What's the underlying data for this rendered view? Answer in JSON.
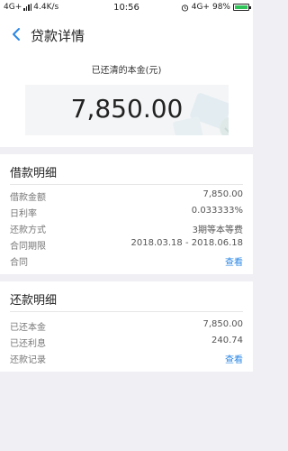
{
  "status_bar": {
    "network": "4G+",
    "speed": "4.4K/s",
    "time": "10:56",
    "network_right": "4G+",
    "battery": "98%",
    "battery_level": 0.98,
    "battery_color": "#2fc35a"
  },
  "nav": {
    "title": "贷款详情",
    "back_icon": "chevron-left-icon"
  },
  "summary": {
    "label": "已还清的本金(元)",
    "amount": "7,850.00"
  },
  "loan_details": {
    "title": "借款明细",
    "rows": [
      {
        "label": "借款金额",
        "value": "7,850.00"
      },
      {
        "label": "日利率",
        "value": "0.033333%"
      },
      {
        "label": "还款方式",
        "value": "3期等本等费"
      },
      {
        "label": "合同期限",
        "value": "2018.03.18 - 2018.06.18"
      },
      {
        "label": "合同",
        "value": "查看"
      }
    ]
  },
  "repay_details": {
    "title": "还款明细",
    "rows": [
      {
        "label": "已还本金",
        "value": "7,850.00"
      },
      {
        "label": "已还利息",
        "value": "240.74"
      },
      {
        "label": "还款记录",
        "value": "查看"
      }
    ]
  },
  "colors": {
    "accent": "#2a87e6",
    "background": "#efeff4"
  }
}
